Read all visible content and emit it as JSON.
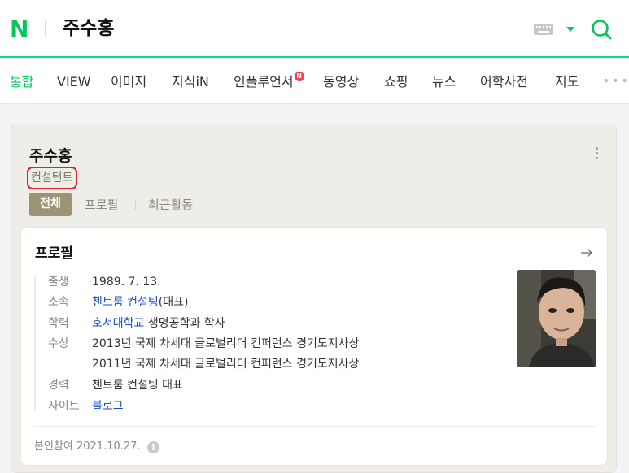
{
  "header": {
    "logo": "N",
    "query": "주수홍",
    "colors": {
      "brand": "#03c75a"
    }
  },
  "tabs": [
    {
      "label": "통합",
      "active": true
    },
    {
      "label": "VIEW"
    },
    {
      "label": "이미지"
    },
    {
      "label": "지식iN"
    },
    {
      "label": "인플루언서",
      "badge": "N"
    },
    {
      "label": "동영상"
    },
    {
      "label": "쇼핑"
    },
    {
      "label": "뉴스"
    },
    {
      "label": "어학사전"
    },
    {
      "label": "지도"
    }
  ],
  "card": {
    "name": "주수홍",
    "occupation": "컨설턴트",
    "subtabs": [
      "전체",
      "프로필",
      "최근활동"
    ],
    "profile": {
      "title": "프로필",
      "rows": [
        {
          "label": "출생",
          "value": "1989. 7. 13."
        },
        {
          "label": "소속",
          "link": "첸트룸 컨설팅",
          "suffix": "(대표)"
        },
        {
          "label": "학력",
          "link": "호서대학교",
          "suffix": " 생명공학과 학사"
        },
        {
          "label": "수상",
          "values": [
            "2013년 국제 차세대 글로벌리더 컨퍼런스 경기도지사상",
            "2011년 국제 차세대 글로벌리더 컨퍼런스 경기도지사상"
          ]
        },
        {
          "label": "경력",
          "value": "첸트룸 컨설팅 대표"
        },
        {
          "label": "사이트",
          "link": "블로그"
        }
      ],
      "footer": "본인참여 2021.10.27."
    }
  }
}
